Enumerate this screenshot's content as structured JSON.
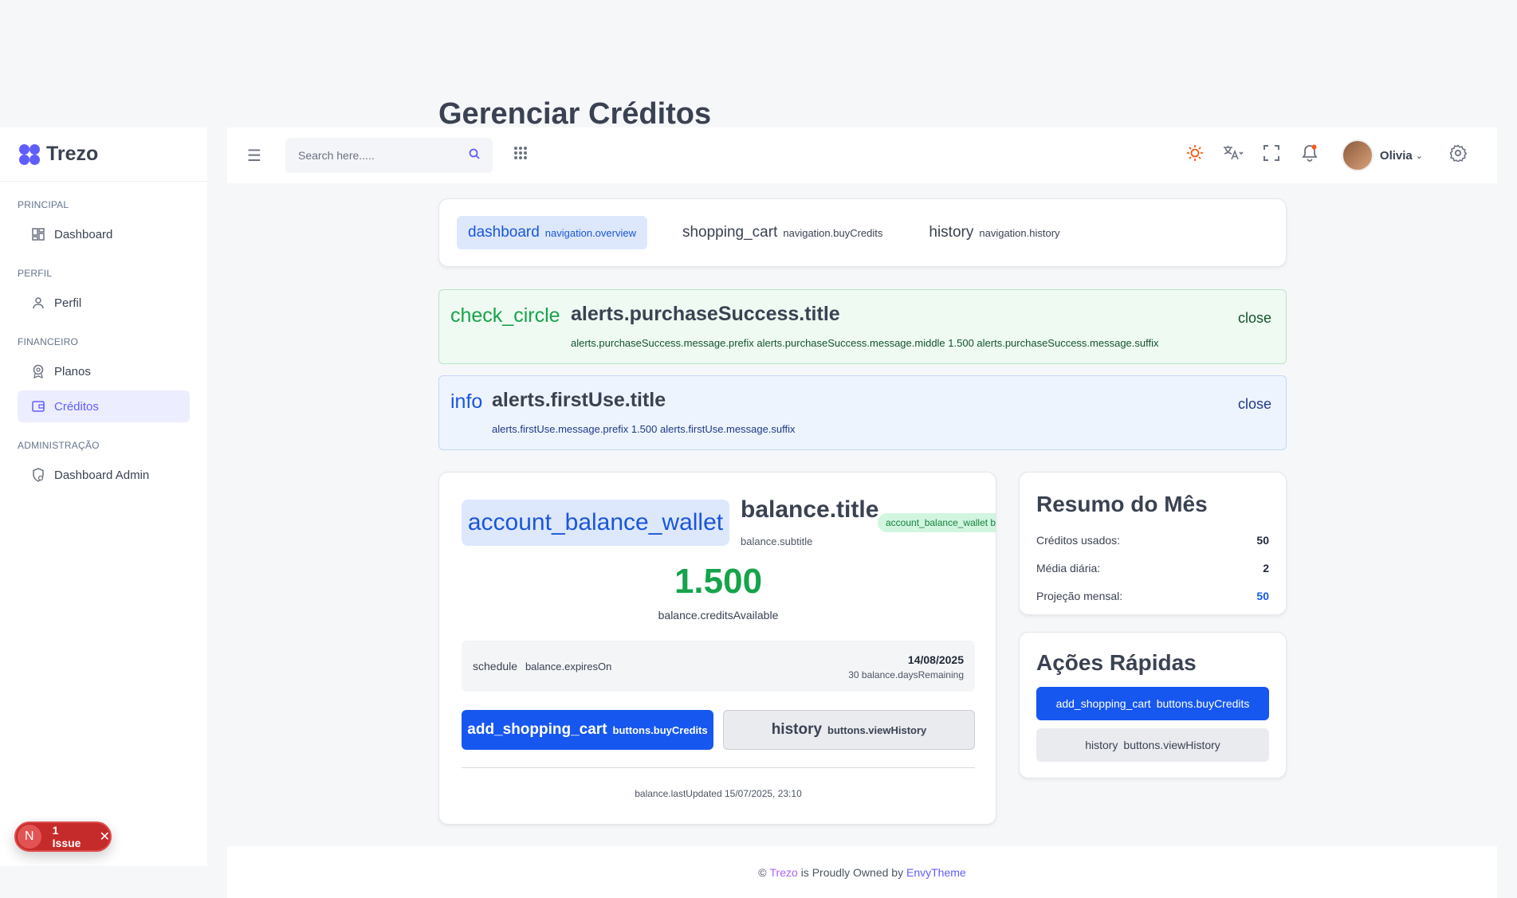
{
  "page": {
    "title": "Gerenciar Créditos"
  },
  "brand": {
    "name": "Trezo",
    "color": "#605dff"
  },
  "sidebar": {
    "sections": [
      {
        "heading": "PRINCIPAL",
        "items": [
          {
            "label": "Dashboard",
            "icon": "dashboard-grid-icon"
          }
        ]
      },
      {
        "heading": "PERFIL",
        "items": [
          {
            "label": "Perfil",
            "icon": "user-icon"
          }
        ]
      },
      {
        "heading": "FINANCEIRO",
        "items": [
          {
            "label": "Planos",
            "icon": "award-icon"
          },
          {
            "label": "Créditos",
            "icon": "wallet-icon",
            "active": true
          }
        ]
      },
      {
        "heading": "ADMINISTRAÇÃO",
        "items": [
          {
            "label": "Dashboard Admin",
            "icon": "admin-shield-icon"
          }
        ]
      }
    ]
  },
  "issue_badge": {
    "letter": "N",
    "label": "1 Issue",
    "close": "✕"
  },
  "header": {
    "menu_icon": "☰",
    "search": {
      "placeholder": "Search here.....",
      "value": ""
    },
    "search_icon": "⌕",
    "apps_icon": "⠿",
    "user": {
      "name": "Olivia",
      "caret": "⌄"
    }
  },
  "tabs": [
    {
      "icon": "dashboard",
      "label": "navigation.overview",
      "active": true
    },
    {
      "icon": "shopping_cart",
      "label": "navigation.buyCredits"
    },
    {
      "icon": "history",
      "label": "navigation.history"
    }
  ],
  "alerts": {
    "success": {
      "icon": "check_circle",
      "title": "alerts.purchaseSuccess.title",
      "message": "alerts.purchaseSuccess.message.prefix alerts.purchaseSuccess.message.middle 1.500 alerts.purchaseSuccess.message.suffix",
      "close": "close"
    },
    "info": {
      "icon": "info",
      "title": "alerts.firstUse.title",
      "message": "alerts.firstUse.message.prefix 1.500 alerts.firstUse.message.suffix",
      "close": "close"
    }
  },
  "balance": {
    "icon": "account_balance_wallet",
    "title": "balance.title",
    "subtitle": "balance.subtitle",
    "badge": "account_balance_wallet balance.active",
    "amount": "1.500",
    "available_label": "balance.creditsAvailable",
    "expires": {
      "icon": "schedule",
      "label": "balance.expiresOn",
      "date": "14/08/2025",
      "days": "30 balance.daysRemaining"
    },
    "buy_button": {
      "icon": "add_shopping_cart",
      "label": "buttons.buyCredits"
    },
    "history_button": {
      "icon": "history",
      "label": "buttons.viewHistory"
    },
    "last_updated": "balance.lastUpdated 15/07/2025, 23:10"
  },
  "summary": {
    "title": "Resumo do Mês",
    "rows": [
      {
        "label": "Créditos usados:",
        "value": "50"
      },
      {
        "label": "Média diária:",
        "value": "2"
      },
      {
        "label": "Projeção mensal:",
        "value": "50"
      }
    ]
  },
  "quick_actions": {
    "title": "Ações Rápidas",
    "buy": {
      "icon": "add_shopping_cart",
      "label": "buttons.buyCredits"
    },
    "history": {
      "icon": "history",
      "label": "buttons.viewHistory"
    }
  },
  "footer": {
    "prefix": "©",
    "brand": "Trezo",
    "middle": "is Proudly Owned by",
    "company": "EnvyTheme"
  },
  "colors": {
    "primary_blue": "#1657f0",
    "success_green": "#16a34a",
    "accent_purple": "#605dff",
    "sun_orange": "#fd5812"
  }
}
